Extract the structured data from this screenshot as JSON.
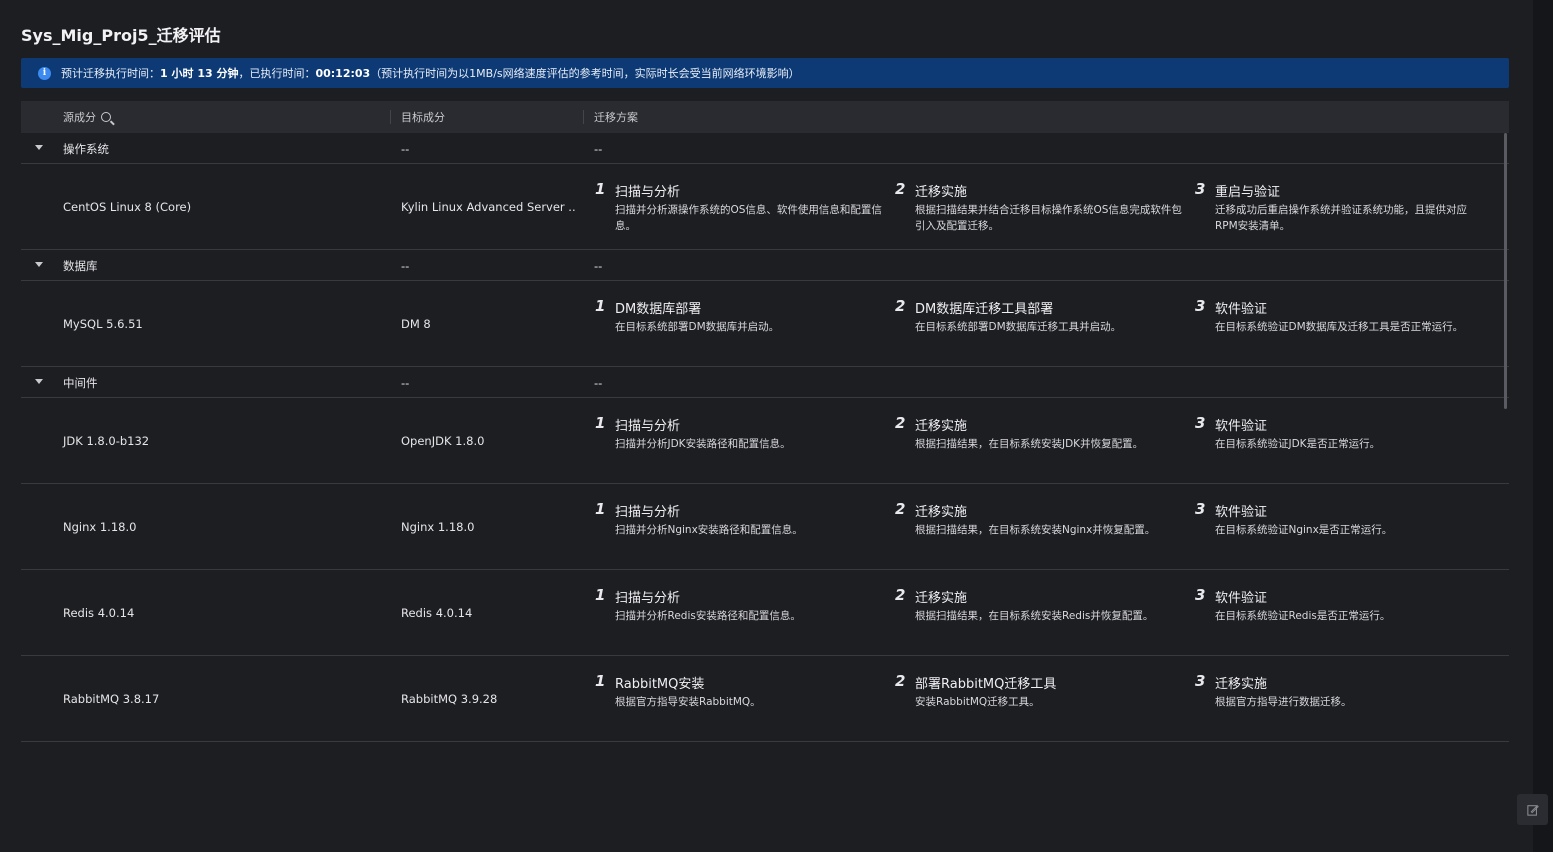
{
  "page": {
    "title": "Sys_Mig_Proj5_迁移评估"
  },
  "banner": {
    "label_estimated": "预计迁移执行时间：",
    "estimated": "1 小时 13 分钟",
    "label_elapsed": "，已执行时间：",
    "elapsed": "00:12:03",
    "note": "（预计执行时间为以1MB/s网络速度评估的参考时间，实际时长会受当前网络环境影响）",
    "icon": "info-icon"
  },
  "table": {
    "headers": {
      "source": "源成分",
      "target": "目标成分",
      "plan": "迁移方案"
    },
    "groups": [
      {
        "name": "操作系统",
        "target": "--",
        "plan": "--",
        "rows": [
          {
            "source": "CentOS Linux 8 (Core)",
            "target": "Kylin Linux Advanced Server ...",
            "steps": [
              {
                "num": "1",
                "title": "扫描与分析",
                "desc": "扫描并分析源操作系统的OS信息、软件使用信息和配置信息。"
              },
              {
                "num": "2",
                "title": "迁移实施",
                "desc": "根据扫描结果并结合迁移目标操作系统OS信息完成软件包引入及配置迁移。"
              },
              {
                "num": "3",
                "title": "重启与验证",
                "desc": "迁移成功后重启操作系统并验证系统功能，且提供对应RPM安装清单。"
              }
            ]
          }
        ]
      },
      {
        "name": "数据库",
        "target": "--",
        "plan": "--",
        "rows": [
          {
            "source": "MySQL 5.6.51",
            "target": "DM 8",
            "steps": [
              {
                "num": "1",
                "title": "DM数据库部署",
                "desc": "在目标系统部署DM数据库并启动。"
              },
              {
                "num": "2",
                "title": "DM数据库迁移工具部署",
                "desc": "在目标系统部署DM数据库迁移工具并启动。"
              },
              {
                "num": "3",
                "title": "软件验证",
                "desc": "在目标系统验证DM数据库及迁移工具是否正常运行。"
              }
            ]
          }
        ]
      },
      {
        "name": "中间件",
        "target": "--",
        "plan": "--",
        "rows": [
          {
            "source": "JDK 1.8.0-b132",
            "target": "OpenJDK 1.8.0",
            "steps": [
              {
                "num": "1",
                "title": "扫描与分析",
                "desc": "扫描并分析JDK安装路径和配置信息。"
              },
              {
                "num": "2",
                "title": "迁移实施",
                "desc": "根据扫描结果，在目标系统安装JDK并恢复配置。"
              },
              {
                "num": "3",
                "title": "软件验证",
                "desc": "在目标系统验证JDK是否正常运行。"
              }
            ]
          },
          {
            "source": "Nginx 1.18.0",
            "target": "Nginx 1.18.0",
            "steps": [
              {
                "num": "1",
                "title": "扫描与分析",
                "desc": "扫描并分析Nginx安装路径和配置信息。"
              },
              {
                "num": "2",
                "title": "迁移实施",
                "desc": "根据扫描结果，在目标系统安装Nginx并恢复配置。"
              },
              {
                "num": "3",
                "title": "软件验证",
                "desc": "在目标系统验证Nginx是否正常运行。"
              }
            ]
          },
          {
            "source": "Redis 4.0.14",
            "target": "Redis 4.0.14",
            "steps": [
              {
                "num": "1",
                "title": "扫描与分析",
                "desc": "扫描并分析Redis安装路径和配置信息。"
              },
              {
                "num": "2",
                "title": "迁移实施",
                "desc": "根据扫描结果，在目标系统安装Redis并恢复配置。"
              },
              {
                "num": "3",
                "title": "软件验证",
                "desc": "在目标系统验证Redis是否正常运行。"
              }
            ]
          },
          {
            "source": "RabbitMQ 3.8.17",
            "target": "RabbitMQ 3.9.28",
            "steps": [
              {
                "num": "1",
                "title": "RabbitMQ安装",
                "desc": "根据官方指导安装RabbitMQ。"
              },
              {
                "num": "2",
                "title": "部署RabbitMQ迁移工具",
                "desc": "安装RabbitMQ迁移工具。"
              },
              {
                "num": "3",
                "title": "迁移实施",
                "desc": "根据官方指导进行数据迁移。"
              }
            ]
          }
        ]
      }
    ]
  },
  "floating": {
    "edit_icon": "edit-icon"
  },
  "colors": {
    "background": "#1d1e22",
    "banner": "#0d3a75",
    "info_accent": "#3d8bf0",
    "header": "#2a2b30"
  }
}
